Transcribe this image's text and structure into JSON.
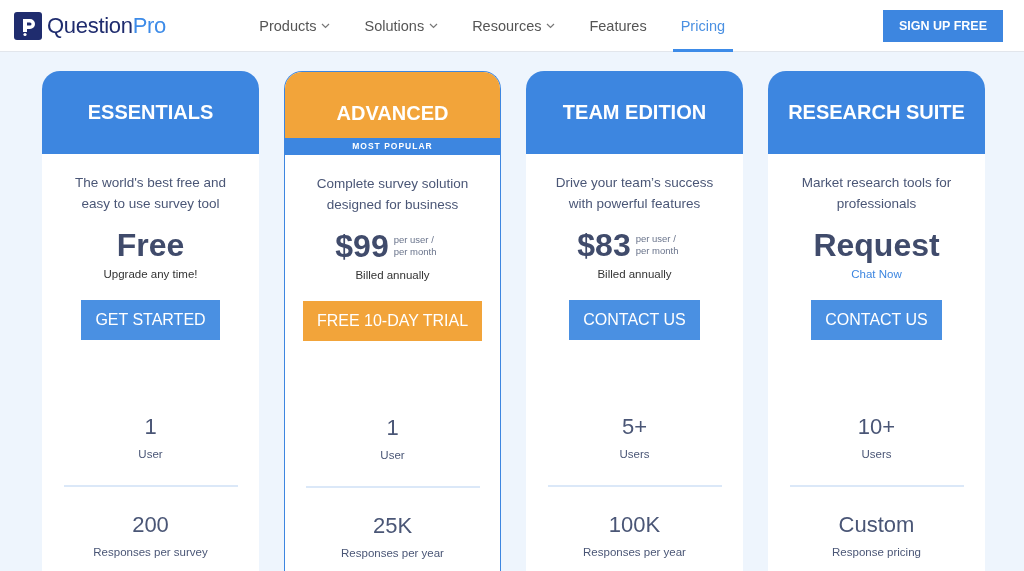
{
  "header": {
    "logo": {
      "name_main": "Question",
      "name_accent": "Pro"
    },
    "nav": [
      {
        "label": "Products",
        "has_menu": true,
        "selected": false
      },
      {
        "label": "Solutions",
        "has_menu": true,
        "selected": false
      },
      {
        "label": "Resources",
        "has_menu": true,
        "selected": false
      },
      {
        "label": "Features",
        "has_menu": false,
        "selected": false
      },
      {
        "label": "Pricing",
        "has_menu": false,
        "selected": true
      }
    ],
    "cta": "SIGN UP FREE"
  },
  "plans": [
    {
      "name": "ESSENTIALS",
      "popular": false,
      "description": "The world's best free and easy to use survey tool",
      "price": "Free",
      "sub": {
        "kind": "text",
        "text": "Upgrade any time!"
      },
      "button": "GET STARTED",
      "stats": [
        {
          "value": "1",
          "label": "User"
        },
        {
          "value": "200",
          "label": "Responses per survey"
        }
      ]
    },
    {
      "name": "ADVANCED",
      "popular": true,
      "badge": "MOST POPULAR",
      "description": "Complete survey solution designed for business",
      "price": "$99",
      "price_note": "per user / per month",
      "sub": {
        "kind": "text",
        "text": "Billed annually"
      },
      "button": "FREE 10-DAY TRIAL",
      "stats": [
        {
          "value": "1",
          "label": "User"
        },
        {
          "value": "25K",
          "label": "Responses per year"
        }
      ]
    },
    {
      "name": "TEAM EDITION",
      "popular": false,
      "description": "Drive your team’s success with powerful features",
      "price": "$83",
      "price_note": "per user / per month",
      "sub": {
        "kind": "text",
        "text": "Billed annually"
      },
      "button": "CONTACT US",
      "stats": [
        {
          "value": "5+",
          "label": "Users"
        },
        {
          "value": "100K",
          "label": "Responses per year"
        }
      ]
    },
    {
      "name": "RESEARCH SUITE",
      "popular": false,
      "description": "Market research tools for professionals",
      "price": "Request",
      "sub": {
        "kind": "link",
        "text": "Chat Now"
      },
      "button": "CONTACT US",
      "stats": [
        {
          "value": "10+",
          "label": "Users"
        },
        {
          "value": "Custom",
          "label": "Response pricing"
        }
      ]
    }
  ]
}
